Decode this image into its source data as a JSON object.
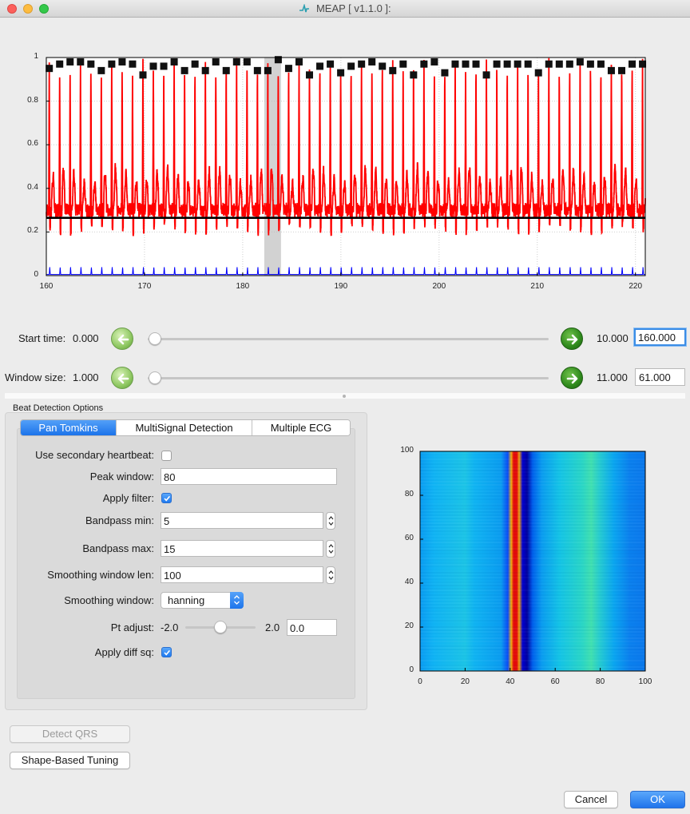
{
  "window": {
    "title": "MEAP [ v1.1.0 ]:"
  },
  "top_plot": {
    "x_ticks": [
      "160",
      "170",
      "180",
      "190",
      "200",
      "210",
      "220"
    ],
    "y_ticks": [
      "0",
      "0.2",
      "0.4",
      "0.6",
      "0.8",
      "1"
    ],
    "colors": {
      "signal": "#ff0000",
      "threshold": "#000000",
      "filtered": "#0000ff",
      "markers": "#111111",
      "selection": "#b4b4b4"
    }
  },
  "start_time": {
    "label": "Start time:",
    "min": "0.000",
    "max": "10.000",
    "value": "160.000"
  },
  "window_size": {
    "label": "Window size:",
    "min": "1.000",
    "max": "11.000",
    "value": "61.000"
  },
  "beat_detection": {
    "group_title": "Beat Detection Options",
    "tabs": [
      "Pan Tomkins",
      "MultiSignal Detection",
      "Multiple ECG"
    ],
    "active_tab": "Pan Tomkins",
    "fields": {
      "use_secondary_label": "Use secondary heartbeat:",
      "use_secondary_checked": false,
      "peak_window_label": "Peak window:",
      "peak_window_value": "80",
      "apply_filter_label": "Apply filter:",
      "apply_filter_checked": true,
      "bandpass_min_label": "Bandpass min:",
      "bandpass_min_value": "5",
      "bandpass_max_label": "Bandpass max:",
      "bandpass_max_value": "15",
      "smoothing_len_label": "Smoothing window len:",
      "smoothing_len_value": "100",
      "smoothing_window_label": "Smoothing window:",
      "smoothing_window_value": "hanning",
      "pt_adjust_label": "Pt adjust:",
      "pt_adjust_min": "-2.0",
      "pt_adjust_max": "2.0",
      "pt_adjust_value": "0.0",
      "apply_diff_label": "Apply diff sq:",
      "apply_diff_checked": true
    }
  },
  "heatmap": {
    "x_ticks": [
      "0",
      "20",
      "40",
      "60",
      "80",
      "100"
    ],
    "y_ticks": [
      "0",
      "20",
      "40",
      "60",
      "80",
      "100"
    ]
  },
  "buttons": {
    "detect_qrs": "Detect QRS",
    "shape_tuning": "Shape-Based Tuning",
    "cancel": "Cancel",
    "ok": "OK"
  }
}
